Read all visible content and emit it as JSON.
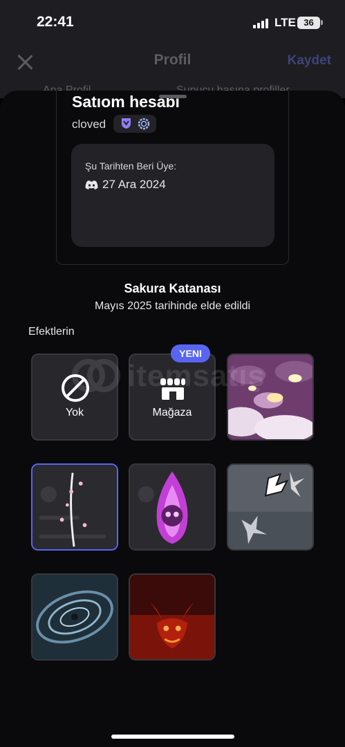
{
  "status_bar": {
    "time": "22:41",
    "network": "LTE",
    "battery": "36"
  },
  "header": {
    "title": "Profil",
    "save_label": "Kaydet",
    "tab_left": "Ana Profil",
    "tab_right": "Sunucu başına profiller"
  },
  "profile": {
    "display_name": "Satıom hesabı",
    "username": "cloved",
    "member_since_label": "Şu Tarihten Beri Üye:",
    "member_since_date": "27 Ara 2024"
  },
  "effect": {
    "name": "Sakura Katanası",
    "acquired": "Mayıs 2025 tarihinde elde edildi"
  },
  "effects_section": {
    "label": "Efektlerin",
    "none_label": "Yok",
    "shop_label": "Mağaza",
    "new_badge": "YENI",
    "items": [
      {
        "name": "pink-clouds-effect"
      },
      {
        "name": "sakura-katana-effect",
        "selected": true
      },
      {
        "name": "purple-flame-skull-effect"
      },
      {
        "name": "shuriken-manga-effect"
      },
      {
        "name": "blue-vortex-effect"
      },
      {
        "name": "red-dragon-effect"
      }
    ]
  },
  "watermark": {
    "text": "itemsatış"
  },
  "colors": {
    "accent": "#5865f2",
    "sheet_bg": "#0a0a0c",
    "tile_bg": "#27272c"
  }
}
